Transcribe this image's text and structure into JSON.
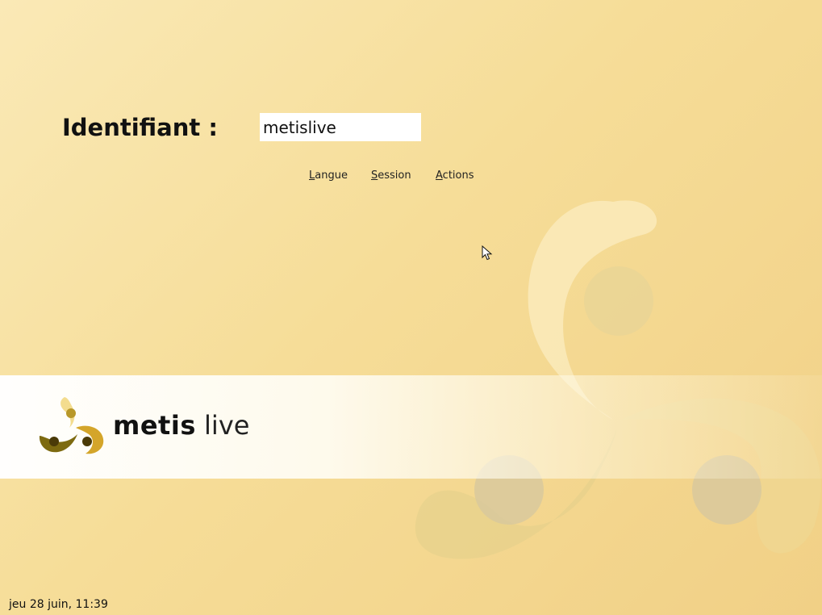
{
  "login": {
    "label": "Identifiant :",
    "username_value": "metislive"
  },
  "menus": [
    {
      "mnemonic": "L",
      "rest": "angue"
    },
    {
      "mnemonic": "S",
      "rest": "ession"
    },
    {
      "mnemonic": "A",
      "rest": "ctions"
    }
  ],
  "branding": {
    "name_bold": "metis",
    "name_light": "live"
  },
  "clock": {
    "text": "jeu 28 juin, 11:39"
  },
  "colors": {
    "background_light": "#fae9b6",
    "background_dark": "#f1d086",
    "logo_gold": "#d4a52a",
    "logo_olive": "#7d6a10",
    "logo_cream": "#f3dc8e"
  }
}
